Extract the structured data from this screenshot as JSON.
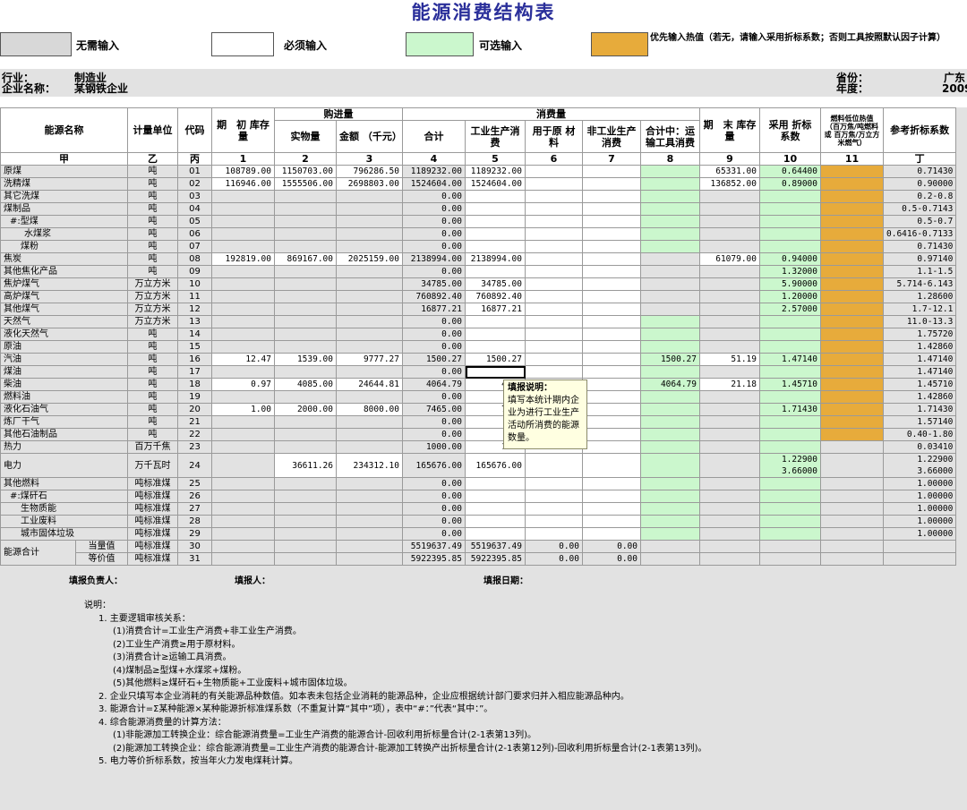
{
  "title": "能源消费结构表",
  "legend": [
    {
      "label": "无需输入",
      "color": "#d8d8d8"
    },
    {
      "label": "必须输入",
      "color": "#ffffff"
    },
    {
      "label": "可选输入",
      "color": "#cbf7cd"
    },
    {
      "label": "优先输入热值（若无，请输入采用折标系数；否则工具按照默认因子计算）",
      "color": "#e7ab3b"
    }
  ],
  "info": {
    "industry_label": "行业：",
    "industry": "制造业",
    "company_label": "企业名称：",
    "company": "某钢铁企业",
    "province_label": "省份：",
    "province": "广东",
    "year_label": "年度：",
    "year": "2009"
  },
  "headers": {
    "name": "能源名称",
    "unit": "计量单位",
    "code": "代码",
    "opening_stock": "期　初 库存量",
    "purchase": "购进量",
    "physical": "实物量",
    "amount": "金额 （千元）",
    "consumption": "消费量",
    "total": "合计",
    "industrial": "工业生产消费",
    "raw_material": "用于原 材料",
    "non_industrial": "非工业生产消费",
    "transport": "合计中：运输工具消费",
    "closing_stock": "期　末 库存量",
    "used_factor": "采用 折标 系数",
    "heat_value": "燃料低位热值（百万焦/吨燃料 或 百万焦/万立方米燃气）",
    "ref_factor": "参考折标系数",
    "col_labels": [
      "甲",
      "乙",
      "丙",
      "1",
      "2",
      "3",
      "4",
      "5",
      "6",
      "7",
      "8",
      "9",
      "10",
      "11",
      "丁"
    ]
  },
  "rows": [
    {
      "name": "原煤",
      "unit": "吨",
      "code": "01",
      "c1": "108789.00",
      "c2": "1150703.00",
      "c3": "796286.50",
      "c4": "1189232.00",
      "c5": "1189232.00",
      "c6": "",
      "c7": "",
      "c8": "",
      "c9": "65331.00",
      "c10": "0.64400",
      "c11": "",
      "ref": "0.71430"
    },
    {
      "name": "洗精煤",
      "unit": "吨",
      "code": "02",
      "c1": "116946.00",
      "c2": "1555506.00",
      "c3": "2698803.00",
      "c4": "1524604.00",
      "c5": "1524604.00",
      "c6": "",
      "c7": "",
      "c8": "",
      "c9": "136852.00",
      "c10": "0.89000",
      "c11": "",
      "ref": "0.90000"
    },
    {
      "name": "其它洗煤",
      "unit": "吨",
      "code": "03",
      "c1": "",
      "c2": "",
      "c3": "",
      "c4": "0.00",
      "c5": "",
      "c6": "",
      "c7": "",
      "c8": "",
      "c9": "",
      "c10": "",
      "c11": "",
      "ref": "0.2-0.8"
    },
    {
      "name": "煤制品",
      "unit": "吨",
      "code": "04",
      "c1": "",
      "c2": "",
      "c3": "",
      "c4": "0.00",
      "c5": "",
      "c6": "",
      "c7": "",
      "c8": "",
      "c9": "",
      "c10": "",
      "c11": "",
      "ref": "0.5-0.7143"
    },
    {
      "name": "#:型煤",
      "unit": "吨",
      "code": "05",
      "c1": "",
      "c2": "",
      "c3": "",
      "c4": "0.00",
      "c5": "",
      "c6": "",
      "c7": "",
      "c8": "",
      "c9": "",
      "c10": "",
      "c11": "",
      "ref": "0.5-0.7"
    },
    {
      "name": "水煤浆",
      "unit": "吨",
      "code": "06",
      "c1": "",
      "c2": "",
      "c3": "",
      "c4": "0.00",
      "c5": "",
      "c6": "",
      "c7": "",
      "c8": "",
      "c9": "",
      "c10": "",
      "c11": "",
      "ref": "0.6416-0.7133"
    },
    {
      "name": "煤粉",
      "unit": "吨",
      "code": "07",
      "c1": "",
      "c2": "",
      "c3": "",
      "c4": "0.00",
      "c5": "",
      "c6": "",
      "c7": "",
      "c8": "",
      "c9": "",
      "c10": "",
      "c11": "",
      "ref": "0.71430"
    },
    {
      "name": "焦炭",
      "unit": "吨",
      "code": "08",
      "c1": "192819.00",
      "c2": "869167.00",
      "c3": "2025159.00",
      "c4": "2138994.00",
      "c5": "2138994.00",
      "c6": "",
      "c7": "",
      "c8": "",
      "c9": "61079.00",
      "c10": "0.94000",
      "c11": "",
      "ref": "0.97140"
    },
    {
      "name": "其他焦化产品",
      "unit": "吨",
      "code": "09",
      "c1": "",
      "c2": "",
      "c3": "",
      "c4": "0.00",
      "c5": "",
      "c6": "",
      "c7": "",
      "c8": "",
      "c9": "",
      "c10": "1.32000",
      "c11": "",
      "ref": "1.1-1.5"
    },
    {
      "name": "焦炉煤气",
      "unit": "万立方米",
      "code": "10",
      "c1": "",
      "c2": "",
      "c3": "",
      "c4": "34785.00",
      "c5": "34785.00",
      "c6": "",
      "c7": "",
      "c8": "",
      "c9": "",
      "c10": "5.90000",
      "c11": "",
      "ref": "5.714-6.143"
    },
    {
      "name": "高炉煤气",
      "unit": "万立方米",
      "code": "11",
      "c1": "",
      "c2": "",
      "c3": "",
      "c4": "760892.40",
      "c5": "760892.40",
      "c6": "",
      "c7": "",
      "c8": "",
      "c9": "",
      "c10": "1.20000",
      "c11": "",
      "ref": "1.28600"
    },
    {
      "name": "其他煤气",
      "unit": "万立方米",
      "code": "12",
      "c1": "",
      "c2": "",
      "c3": "",
      "c4": "16877.21",
      "c5": "16877.21",
      "c6": "",
      "c7": "",
      "c8": "",
      "c9": "",
      "c10": "2.57000",
      "c11": "",
      "ref": "1.7-12.1"
    },
    {
      "name": "天然气",
      "unit": "万立方米",
      "code": "13",
      "c1": "",
      "c2": "",
      "c3": "",
      "c4": "0.00",
      "c5": "",
      "c6": "",
      "c7": "",
      "c8": "",
      "c9": "",
      "c10": "",
      "c11": "",
      "ref": "11.0-13.3"
    },
    {
      "name": "液化天然气",
      "unit": "吨",
      "code": "14",
      "c1": "",
      "c2": "",
      "c3": "",
      "c4": "0.00",
      "c5": "",
      "c6": "",
      "c7": "",
      "c8": "",
      "c9": "",
      "c10": "",
      "c11": "",
      "ref": "1.75720"
    },
    {
      "name": "原油",
      "unit": "吨",
      "code": "15",
      "c1": "",
      "c2": "",
      "c3": "",
      "c4": "0.00",
      "c5": "",
      "c6": "",
      "c7": "",
      "c8": "",
      "c9": "",
      "c10": "",
      "c11": "",
      "ref": "1.42860"
    },
    {
      "name": "汽油",
      "unit": "吨",
      "code": "16",
      "c1": "12.47",
      "c2": "1539.00",
      "c3": "9777.27",
      "c4": "1500.27",
      "c5": "1500.27",
      "c6": "",
      "c7": "",
      "c8": "1500.27",
      "c9": "51.19",
      "c10": "1.47140",
      "c11": "",
      "ref": "1.47140"
    },
    {
      "name": "煤油",
      "unit": "吨",
      "code": "17",
      "c1": "",
      "c2": "",
      "c3": "",
      "c4": "0.00",
      "c5": "",
      "c6": "",
      "c7": "",
      "c8": "",
      "c9": "",
      "c10": "",
      "c11": "",
      "ref": "1.47140"
    },
    {
      "name": "柴油",
      "unit": "吨",
      "code": "18",
      "c1": "0.97",
      "c2": "4085.00",
      "c3": "24644.81",
      "c4": "4064.79",
      "c5": "4064",
      "c6": "",
      "c7": "",
      "c8": "4064.79",
      "c9": "21.18",
      "c10": "1.45710",
      "c11": "",
      "ref": "1.45710"
    },
    {
      "name": "燃料油",
      "unit": "吨",
      "code": "19",
      "c1": "",
      "c2": "",
      "c3": "",
      "c4": "0.00",
      "c5": "",
      "c6": "",
      "c7": "",
      "c8": "",
      "c9": "",
      "c10": "",
      "c11": "",
      "ref": "1.42860"
    },
    {
      "name": "液化石油气",
      "unit": "吨",
      "code": "20",
      "c1": "1.00",
      "c2": "2000.00",
      "c3": "8000.00",
      "c4": "7465.00",
      "c5": "7465",
      "c6": "",
      "c7": "",
      "c8": "",
      "c9": "",
      "c10": "1.71430",
      "c11": "",
      "ref": "1.71430"
    },
    {
      "name": "炼厂干气",
      "unit": "吨",
      "code": "21",
      "c1": "",
      "c2": "",
      "c3": "",
      "c4": "0.00",
      "c5": "",
      "c6": "",
      "c7": "",
      "c8": "",
      "c9": "",
      "c10": "",
      "c11": "",
      "ref": "1.57140"
    },
    {
      "name": "其他石油制品",
      "unit": "吨",
      "code": "22",
      "c1": "",
      "c2": "",
      "c3": "",
      "c4": "0.00",
      "c5": "",
      "c6": "",
      "c7": "",
      "c8": "",
      "c9": "",
      "c10": "",
      "c11": "",
      "ref": "0.40-1.80"
    },
    {
      "name": "热力",
      "unit": "百万千焦",
      "code": "23",
      "c1": "",
      "c2": "",
      "c3": "",
      "c4": "1000.00",
      "c5": "1000",
      "c6": "",
      "c7": "",
      "c8": "",
      "c9": "",
      "c10": "",
      "c11": "",
      "ref": "0.03410"
    },
    {
      "name": "电力",
      "unit": "万千瓦时",
      "code": "24",
      "c1": "",
      "c2": "36611.26",
      "c3": "234312.10",
      "c4": "165676.00",
      "c5": "165676.00",
      "c6": "",
      "c7": "",
      "c8": "",
      "c9": "",
      "c10": "1.22900",
      "c10b": "3.66000",
      "c11": "",
      "ref": "1.22900",
      "refb": "3.66000"
    },
    {
      "name": "其他燃料",
      "unit": "吨标准煤",
      "code": "25",
      "c1": "",
      "c2": "",
      "c3": "",
      "c4": "0.00",
      "c5": "",
      "c6": "",
      "c7": "",
      "c8": "",
      "c9": "",
      "c10": "",
      "c11": "",
      "ref": "1.00000"
    },
    {
      "name": "#:煤矸石",
      "unit": "吨标准煤",
      "code": "26",
      "c1": "",
      "c2": "",
      "c3": "",
      "c4": "0.00",
      "c5": "",
      "c6": "",
      "c7": "",
      "c8": "",
      "c9": "",
      "c10": "",
      "c11": "",
      "ref": "1.00000"
    },
    {
      "name": "生物质能",
      "unit": "吨标准煤",
      "code": "27",
      "c1": "",
      "c2": "",
      "c3": "",
      "c4": "0.00",
      "c5": "",
      "c6": "",
      "c7": "",
      "c8": "",
      "c9": "",
      "c10": "",
      "c11": "",
      "ref": "1.00000"
    },
    {
      "name": "工业废料",
      "unit": "吨标准煤",
      "code": "28",
      "c1": "",
      "c2": "",
      "c3": "",
      "c4": "0.00",
      "c5": "",
      "c6": "",
      "c7": "",
      "c8": "",
      "c9": "",
      "c10": "",
      "c11": "",
      "ref": "1.00000"
    },
    {
      "name": "城市固体垃圾",
      "unit": "吨标准煤",
      "code": "29",
      "c1": "",
      "c2": "",
      "c3": "",
      "c4": "0.00",
      "c5": "",
      "c6": "",
      "c7": "",
      "c8": "",
      "c9": "",
      "c10": "",
      "c11": "",
      "ref": "1.00000"
    }
  ],
  "totals": {
    "label": "能源合计",
    "rows": [
      {
        "sub": "当量值",
        "unit": "吨标准煤",
        "code": "30",
        "c4": "5519637.49",
        "c5": "5519637.49",
        "c6": "0.00",
        "c7": "0.00"
      },
      {
        "sub": "等价值",
        "unit": "吨标准煤",
        "code": "31",
        "c4": "5922395.85",
        "c5": "5922395.85",
        "c6": "0.00",
        "c7": "0.00"
      }
    ]
  },
  "tooltip": {
    "title": "填报说明：",
    "body": "填写本统计期内企业为进行工业生产活动所消费的能源数量。"
  },
  "footer": {
    "responsible": "填报负责人：",
    "filler": "填报人：",
    "date": "填报日期："
  },
  "notes": {
    "heading": "说明：",
    "lines": [
      {
        "level": 1,
        "text": "1. 主要逻辑审核关系："
      },
      {
        "level": 2,
        "text": "(1)消费合计=工业生产消费+非工业生产消费。"
      },
      {
        "level": 2,
        "text": "(2)工业生产消费≥用于原材料。"
      },
      {
        "level": 2,
        "text": "(3)消费合计≥运输工具消费。"
      },
      {
        "level": 2,
        "text": "(4)煤制品≥型煤+水煤浆+煤粉。"
      },
      {
        "level": 2,
        "text": "(5)其他燃料≥煤矸石+生物质能+工业废料+城市固体垃圾。"
      },
      {
        "level": 1,
        "text": "2. 企业只填写本企业消耗的有关能源品种数值。如本表未包括企业消耗的能源品种，企业应根据统计部门要求归并入相应能源品种内。"
      },
      {
        "level": 1,
        "text": "3. 能源合计=Σ某种能源×某种能源折标准煤系数（不重复计算“其中”项），表中“#：”代表“其中：”。"
      },
      {
        "level": 1,
        "text": "4. 综合能源消费量的计算方法："
      },
      {
        "level": 2,
        "text": "(1)非能源加工转换企业：综合能源消费量=工业生产消费的能源合计-回收利用折标量合计(2-1表第13列)。"
      },
      {
        "level": 2,
        "text": "(2)能源加工转换企业：综合能源消费量=工业生产消费的能源合计-能源加工转换产出折标量合计(2-1表第12列)-回收利用折标量合计(2-1表第13列)。"
      },
      {
        "level": 1,
        "text": "5. 电力等价折标系数，按当年火力发电煤耗计算。"
      }
    ]
  }
}
